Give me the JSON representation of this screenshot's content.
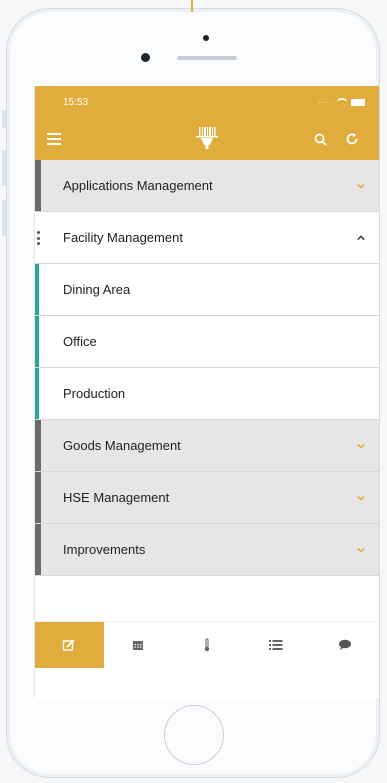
{
  "colors": {
    "accent": "#e0ad3d",
    "category_bar": "#6b6b6b",
    "sub_bar": "#2aa59a"
  },
  "statusbar": {
    "time": "15:53"
  },
  "toolbar": {
    "menu_icon": "hamburger-icon",
    "logo_icon": "barcode-scanner-logo",
    "search_icon": "search-icon",
    "refresh_icon": "refresh-icon"
  },
  "menu": {
    "applications": "Applications Management",
    "facility": "Facility Management",
    "dining": "Dining Area",
    "office": "Office",
    "production": "Production",
    "goods": "Goods Management",
    "hse": "HSE Management",
    "improvements": "Improvements"
  },
  "bottom_nav": [
    "edit-icon",
    "calendar-icon",
    "thermometer-icon",
    "list-icon",
    "chat-icon"
  ]
}
